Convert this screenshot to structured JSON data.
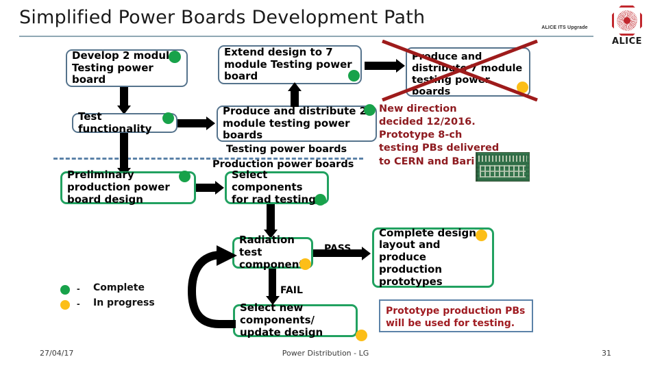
{
  "header": {
    "title": "Simplified Power Boards Development Path",
    "org_tag": "ALICE ITS Upgrade",
    "logo_word": "ALICE"
  },
  "boxes": {
    "develop2": "Develop 2 module Testing power board",
    "extend7": "Extend design to 7 module Testing power board",
    "produce7": "Produce and distribute 7 module testing power boards",
    "test_func": "Test functionality",
    "produce2": "Produce and distribute 2 module testing power boards",
    "prelim": "Preliminary production power board design",
    "select_comp": "Select components for rad testing",
    "rad_test": "Radiation test components",
    "complete_design": "Complete design, layout and produce production prototypes",
    "select_new": "Select new components/ update design"
  },
  "divider": {
    "above_label": "Testing power boards",
    "below_label": "Production power boards"
  },
  "flow_labels": {
    "pass": "PASS",
    "fail": "FAIL"
  },
  "notes": {
    "new_direction": "New direction decided 12/2016. Prototype 8-ch testing PBs delivered to CERN and Bari",
    "prototype_note": "Prototype production PBs will be used for testing."
  },
  "legend": [
    {
      "status": "Complete",
      "dash": "-",
      "color": "#18a24a"
    },
    {
      "status": "In progress",
      "dash": "-",
      "color": "#fcbe18"
    }
  ],
  "footer": {
    "date": "27/04/17",
    "center": "Power Distribution - LG",
    "page": "31"
  },
  "colors": {
    "blue_border": "#55738c",
    "green_border": "#21a160",
    "green_dot": "#18a24a",
    "orange_dot": "#fcbe18",
    "red_cross": "#9e1b1b",
    "red_text": "#8e1b20",
    "divider": "#5b82a8"
  }
}
